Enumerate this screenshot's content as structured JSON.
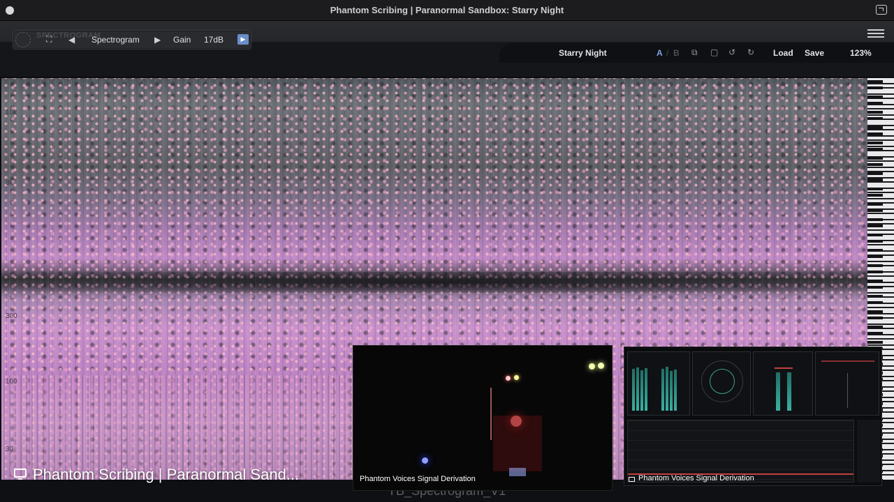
{
  "window": {
    "title": "Phantom Scribing | Paranormal Sandbox: Starry Night"
  },
  "toolbar": {
    "mode_label": "Spectrogram",
    "gain_label": "Gain",
    "gain_value": "17dB",
    "logo_text": "SPECTROGRAM"
  },
  "preset": {
    "name": "Starry Night",
    "a_label": "A",
    "sep": "/",
    "b_label": "B",
    "load_label": "Load",
    "save_label": "Save",
    "zoom": "123%"
  },
  "spectrogram": {
    "freq_labels": [
      "10k",
      "3k",
      "300",
      "100",
      "30"
    ]
  },
  "overlay": {
    "main_title": "Phantom Scribing | Paranormal Sand...",
    "under_text": "YB_Spectrogram_V1"
  },
  "camera_tile": {
    "label": "Phantom Voices Signal Derivation"
  },
  "meters_tile": {
    "label": "Phantom Voices Signal Derivation"
  },
  "colors": {
    "accent": "#6a8ec8",
    "active_ab": "#7fa3e0"
  }
}
